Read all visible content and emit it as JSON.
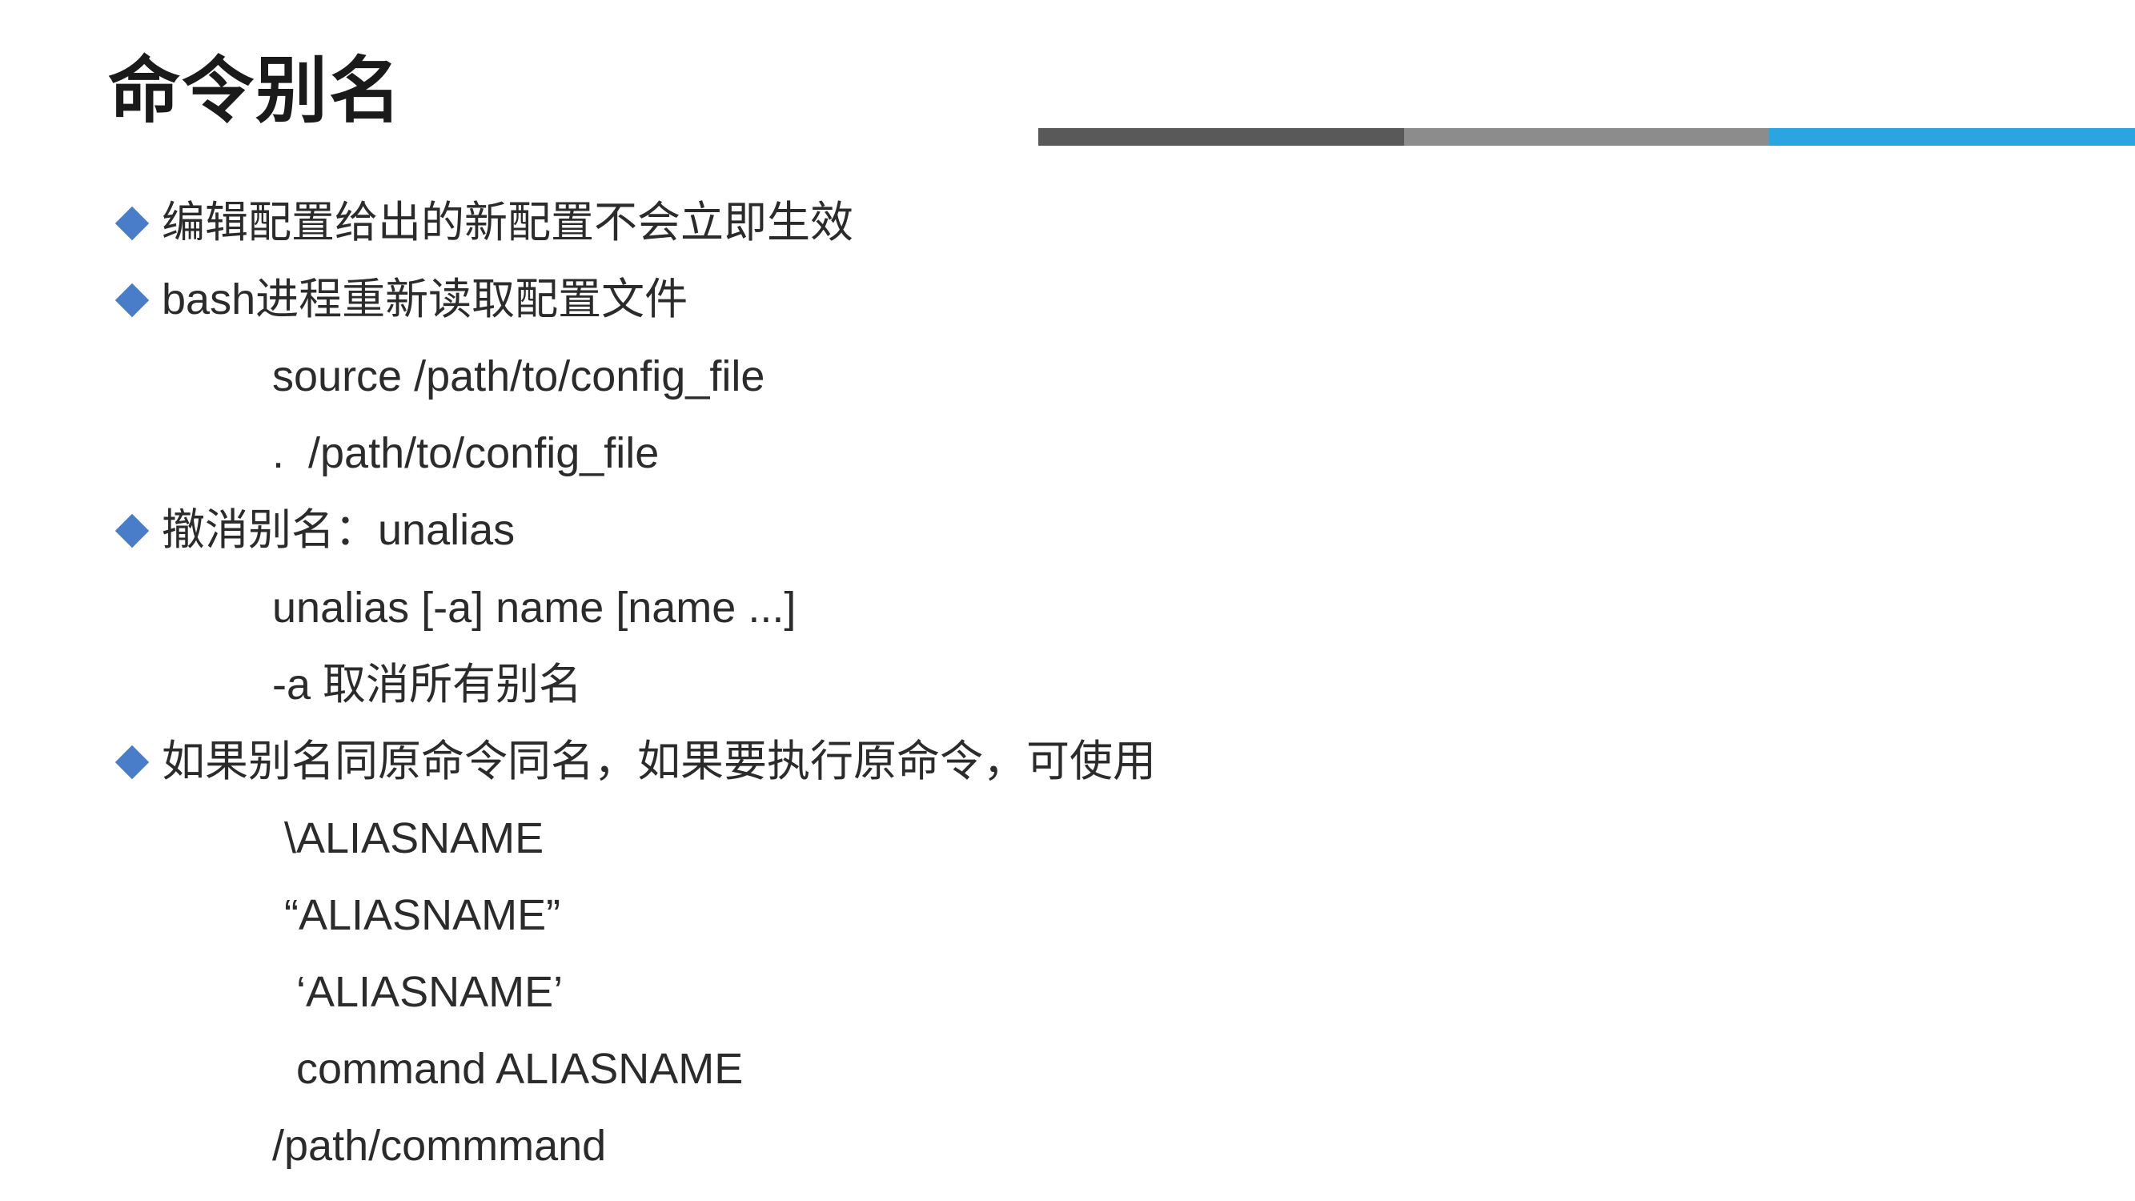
{
  "title": "命令别名",
  "bullets": {
    "b1": "编辑配置给出的新配置不会立即生效",
    "b2": "bash进程重新读取配置文件",
    "b2_sub1": "source /path/to/config_file",
    "b2_sub2": ".  /path/to/config_file",
    "b3": "撤消别名：unalias",
    "b3_sub1": "unalias [-a] name [name ...]",
    "b3_sub2": "-a 取消所有别名",
    "b4": "如果别名同原命令同名，如果要执行原命令，可使用",
    "b4_sub1": " \\ALIASNAME",
    "b4_sub2": " “ALIASNAME”",
    "b4_sub3": "  ‘ALIASNAME’",
    "b4_sub4": "  command ALIASNAME",
    "b4_sub5": "/path/commmand"
  }
}
